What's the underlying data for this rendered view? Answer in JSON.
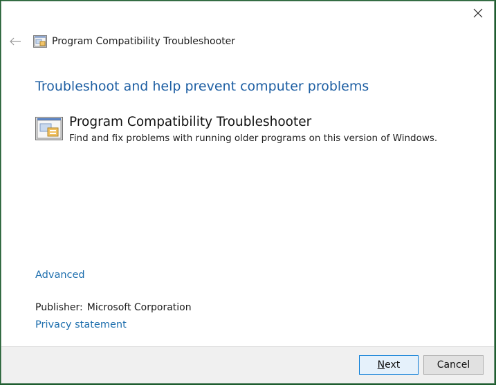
{
  "window": {
    "title": "Program Compatibility Troubleshooter",
    "icons": {
      "close": "close-icon",
      "back": "back-arrow-icon",
      "app": "troubleshooter-icon"
    }
  },
  "main": {
    "heading": "Troubleshoot and help prevent computer problems",
    "troubleshooter": {
      "title": "Program Compatibility Troubleshooter",
      "description": "Find and fix problems with running older programs on this version of Windows."
    },
    "advanced_link": "Advanced",
    "publisher_label": "Publisher:",
    "publisher_value": "Microsoft Corporation",
    "privacy_link": "Privacy statement"
  },
  "footer": {
    "next_label_accel": "N",
    "next_label_rest": "ext",
    "cancel_label": "Cancel"
  },
  "colors": {
    "heading": "#1e5fa3",
    "link": "#1e6fae",
    "default_button_border": "#0078d7"
  }
}
